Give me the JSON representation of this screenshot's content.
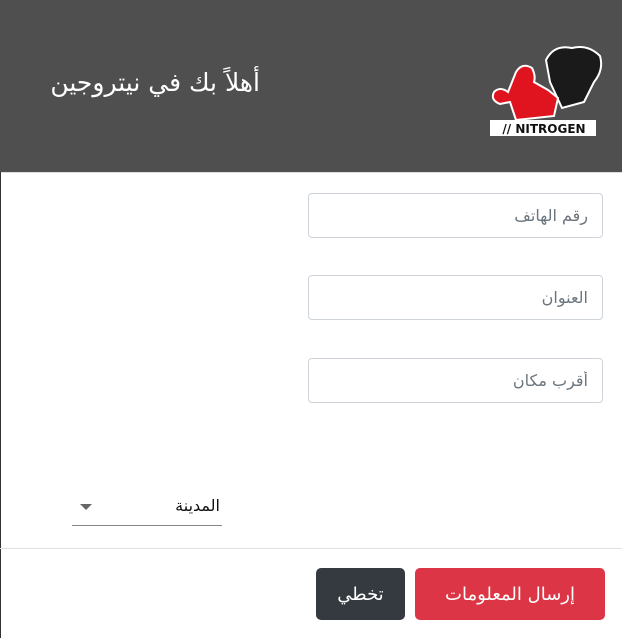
{
  "header": {
    "title": "أهلاً بك في نيتروجين",
    "logo_text": "NITROGEN"
  },
  "form": {
    "phone_placeholder": "رقم الهاتف",
    "address_placeholder": "العنوان",
    "landmark_placeholder": "أقرب مكان",
    "city_select": "المدينة"
  },
  "footer": {
    "send_label": "إرسال المعلومات",
    "skip_label": "تخطي"
  },
  "colors": {
    "header": "#4f4f4f",
    "send": "#dc3545",
    "skip": "#343a40"
  }
}
